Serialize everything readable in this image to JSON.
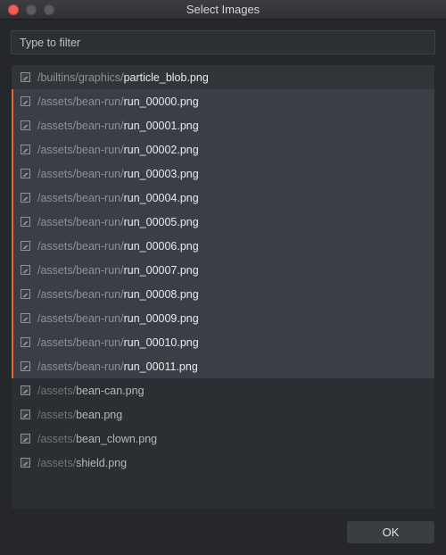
{
  "window": {
    "title": "Select Images"
  },
  "filter": {
    "placeholder": "Type to filter",
    "value": ""
  },
  "list": {
    "items": [
      {
        "dir": "/builtins/graphics/",
        "file": "particle_blob.png",
        "state": "first"
      },
      {
        "dir": "/assets/bean-run/",
        "file": "run_00000.png",
        "state": "selected"
      },
      {
        "dir": "/assets/bean-run/",
        "file": "run_00001.png",
        "state": "selected"
      },
      {
        "dir": "/assets/bean-run/",
        "file": "run_00002.png",
        "state": "selected"
      },
      {
        "dir": "/assets/bean-run/",
        "file": "run_00003.png",
        "state": "selected"
      },
      {
        "dir": "/assets/bean-run/",
        "file": "run_00004.png",
        "state": "selected"
      },
      {
        "dir": "/assets/bean-run/",
        "file": "run_00005.png",
        "state": "selected"
      },
      {
        "dir": "/assets/bean-run/",
        "file": "run_00006.png",
        "state": "selected"
      },
      {
        "dir": "/assets/bean-run/",
        "file": "run_00007.png",
        "state": "selected"
      },
      {
        "dir": "/assets/bean-run/",
        "file": "run_00008.png",
        "state": "selected"
      },
      {
        "dir": "/assets/bean-run/",
        "file": "run_00009.png",
        "state": "selected"
      },
      {
        "dir": "/assets/bean-run/",
        "file": "run_00010.png",
        "state": "selected"
      },
      {
        "dir": "/assets/bean-run/",
        "file": "run_00011.png",
        "state": "selected"
      },
      {
        "dir": "/assets/",
        "file": "bean-can.png",
        "state": "dim"
      },
      {
        "dir": "/assets/",
        "file": "bean.png",
        "state": "dim"
      },
      {
        "dir": "/assets/",
        "file": "bean_clown.png",
        "state": "dim"
      },
      {
        "dir": "/assets/",
        "file": "shield.png",
        "state": "dim"
      }
    ],
    "icon": "image-file-icon"
  },
  "footer": {
    "ok_label": "OK"
  },
  "colors": {
    "selection_accent": "#e2672e",
    "close": "#ee5f57"
  }
}
